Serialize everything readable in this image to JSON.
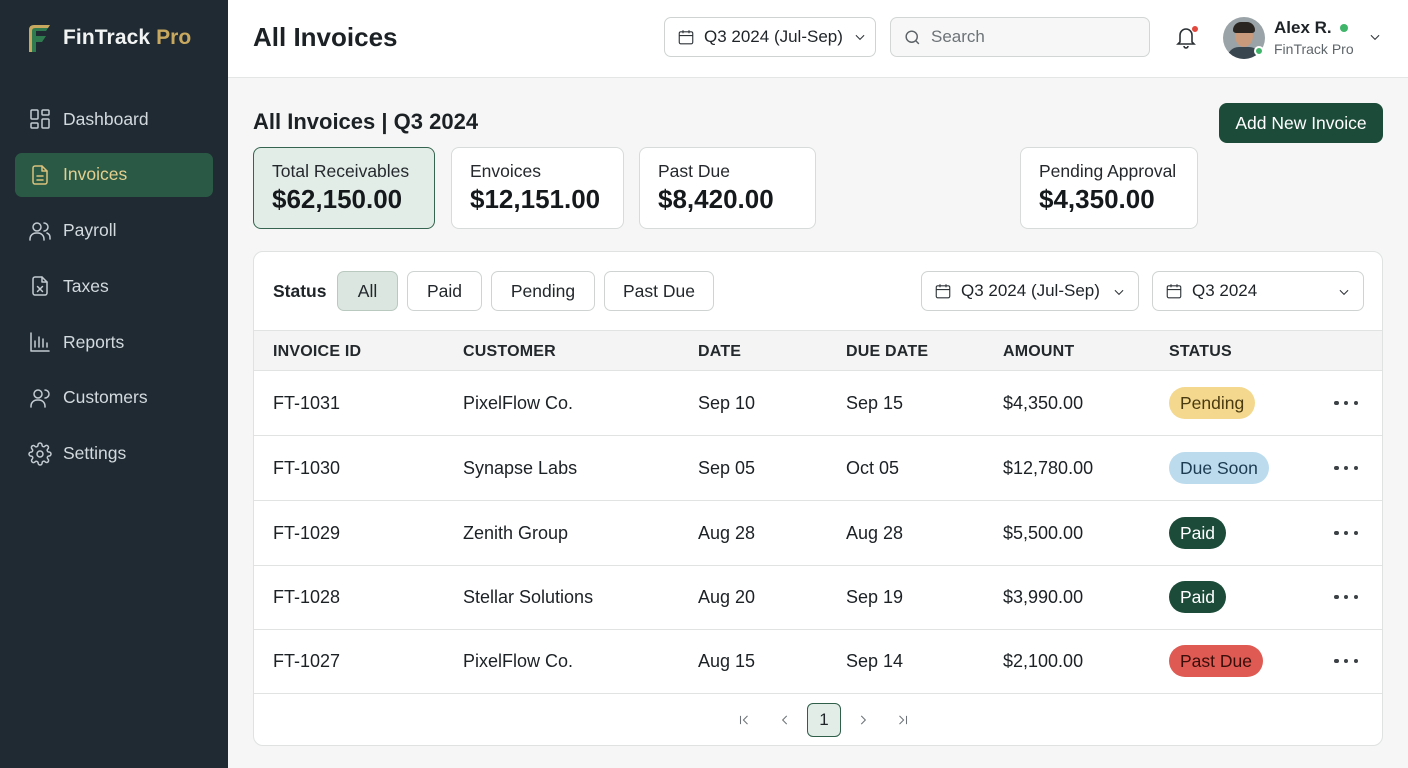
{
  "brand": {
    "name": "FinTrack",
    "accent": "Pro"
  },
  "nav": [
    {
      "label": "Dashboard",
      "icon": "dashboard-icon",
      "active": false
    },
    {
      "label": "Invoices",
      "icon": "document-icon",
      "active": true
    },
    {
      "label": "Payroll",
      "icon": "users-icon",
      "active": false
    },
    {
      "label": "Taxes",
      "icon": "tax-document-icon",
      "active": false
    },
    {
      "label": "Reports",
      "icon": "bar-chart-icon",
      "active": false
    },
    {
      "label": "Customers",
      "icon": "user-icon",
      "active": false
    },
    {
      "label": "Settings",
      "icon": "gear-icon",
      "active": false
    }
  ],
  "header": {
    "title": "All Invoices",
    "period": "Q3 2024 (Jul-Sep)",
    "search_placeholder": "Search",
    "user": {
      "name": "Alex R.",
      "org": "FinTrack Pro"
    }
  },
  "main": {
    "section_title": "All Invoices | Q3 2024",
    "add_button": "Add New Invoice",
    "cards": [
      {
        "label": "Total Receivables",
        "value": "$62,150.00"
      },
      {
        "label": "Envoices",
        "value": "$12,151.00"
      },
      {
        "label": "Past Due",
        "value": "$8,420.00"
      },
      {
        "label": "Pending Approval",
        "value": "$4,350.00"
      }
    ],
    "filters": {
      "status_label": "Status",
      "chips": [
        "All",
        "Paid",
        "Pending",
        "Past Due"
      ],
      "active_chip": "All",
      "period_select": "Q3 2024 (Jul-Sep)",
      "quarter_select": "Q3 2024"
    },
    "table": {
      "columns": [
        "Invoice ID",
        "Customer",
        "Date",
        "Due Date",
        "Amount",
        "Status"
      ],
      "rows": [
        {
          "id": "FT-1031",
          "customer": "PixelFlow Co.",
          "date": "Sep 10",
          "due": "Sep 15",
          "amount": "$4,350.00",
          "status": "Pending",
          "status_type": "pending"
        },
        {
          "id": "FT-1030",
          "customer": "Synapse Labs",
          "date": "Sep 05",
          "due": "Oct 05",
          "amount": "$12,780.00",
          "status": "Due Soon",
          "status_type": "due"
        },
        {
          "id": "FT-1029",
          "customer": "Zenith Group",
          "date": "Aug 28",
          "due": "Aug 28",
          "amount": "$5,500.00",
          "status": "Paid",
          "status_type": "paid"
        },
        {
          "id": "FT-1028",
          "customer": "Stellar Solutions",
          "date": "Aug 20",
          "due": "Sep 19",
          "amount": "$3,990.00",
          "status": "Paid",
          "status_type": "paid"
        },
        {
          "id": "FT-1027",
          "customer": "PixelFlow Co.",
          "date": "Aug 15",
          "due": "Sep 14",
          "amount": "$2,100.00",
          "status": "Past Due",
          "status_type": "pastdue"
        }
      ]
    },
    "pagination": {
      "current_page": "1"
    }
  },
  "colors": {
    "sidebar_bg": "#1f2a33",
    "accent_green": "#1c4c39",
    "brand_gold": "#c8a85f",
    "pending": "#f3d88e",
    "due_soon": "#bcdcee",
    "past_due": "#de5a52"
  }
}
